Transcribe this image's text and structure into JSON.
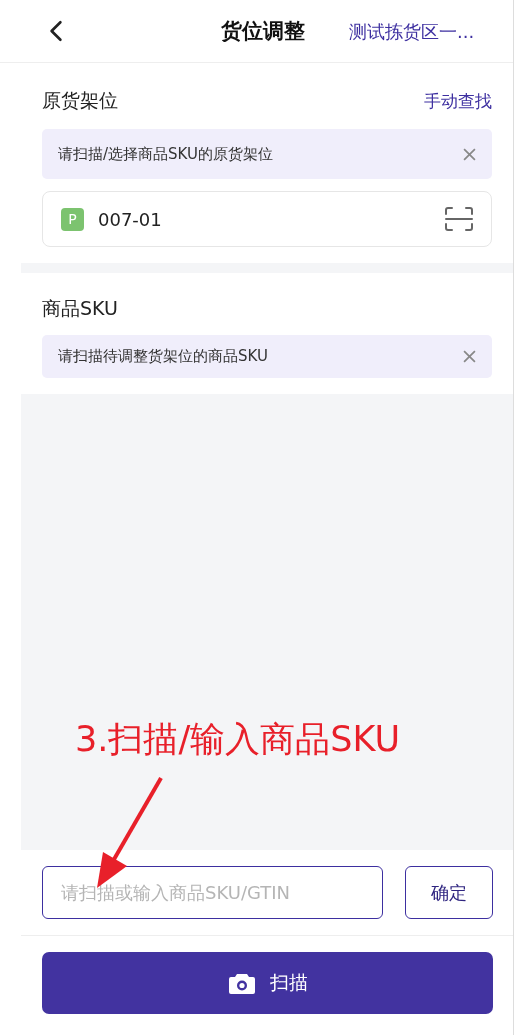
{
  "header": {
    "title": "货位调整",
    "warehouse": "测试拣货区一..."
  },
  "sections": [
    {
      "title": "原货架位",
      "action": "手动查找",
      "hint": "请扫描/选择商品SKU的原货架位",
      "location": {
        "tag": "P",
        "code": "007-01"
      }
    },
    {
      "title": "商品SKU",
      "hint": "请扫描待调整货架位的商品SKU"
    }
  ],
  "annotation": {
    "text": "3.扫描/输入商品SKU"
  },
  "entry": {
    "placeholder": "请扫描或输入商品SKU/GTIN",
    "confirm": "确定"
  },
  "scan_button": {
    "label": "扫描"
  }
}
